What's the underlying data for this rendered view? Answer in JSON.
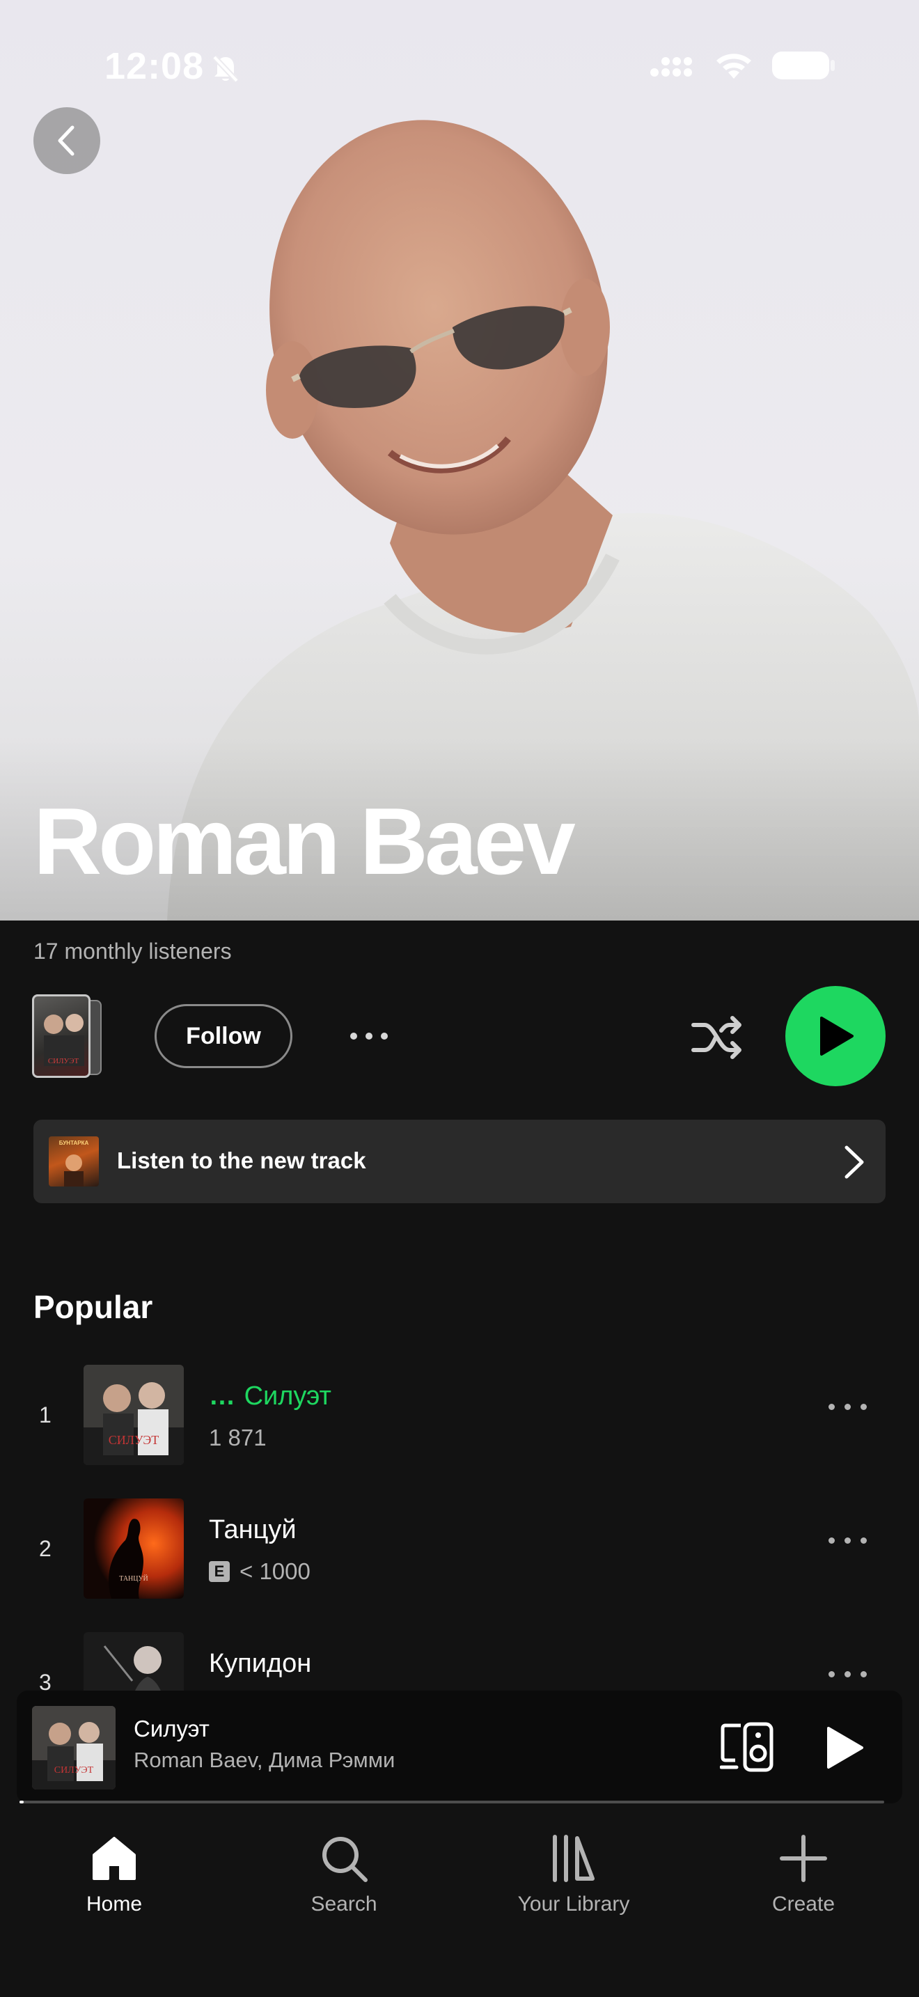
{
  "status_bar": {
    "time": "12:08"
  },
  "artist": {
    "name": "Roman Baev",
    "monthly_listeners": "17 monthly listeners",
    "follow_label": "Follow"
  },
  "new_track_banner": {
    "label": "Listen to the new track",
    "thumb_text": "БУНТАРКА"
  },
  "popular": {
    "title": "Popular",
    "tracks": [
      {
        "num": "1",
        "title": "Силуэт",
        "plays": "1 871",
        "explicit": false,
        "playing": true,
        "art_text": "СИЛУЭТ"
      },
      {
        "num": "2",
        "title": "Танцуй",
        "plays": "< 1000",
        "explicit": true,
        "playing": false,
        "art_text": "ТАНЦУЙ"
      },
      {
        "num": "3",
        "title": "Купидон",
        "plays": "",
        "explicit": false,
        "playing": false,
        "art_text": ""
      }
    ],
    "explicit_badge": "E"
  },
  "now_playing": {
    "title": "Силуэт",
    "artists": "Roman Baev, Дима Рэмми",
    "art_text": "СИЛУЭТ",
    "progress": 0.005
  },
  "nav": {
    "items": [
      {
        "label": "Home",
        "icon": "home-icon",
        "active": true
      },
      {
        "label": "Search",
        "icon": "search-icon",
        "active": false
      },
      {
        "label": "Your Library",
        "icon": "library-icon",
        "active": false
      },
      {
        "label": "Create",
        "icon": "plus-icon",
        "active": false
      }
    ]
  },
  "colors": {
    "accent": "#1ed760",
    "background": "#121212",
    "card": "#2a2a2a",
    "secondary_text": "#b3b3b3"
  }
}
